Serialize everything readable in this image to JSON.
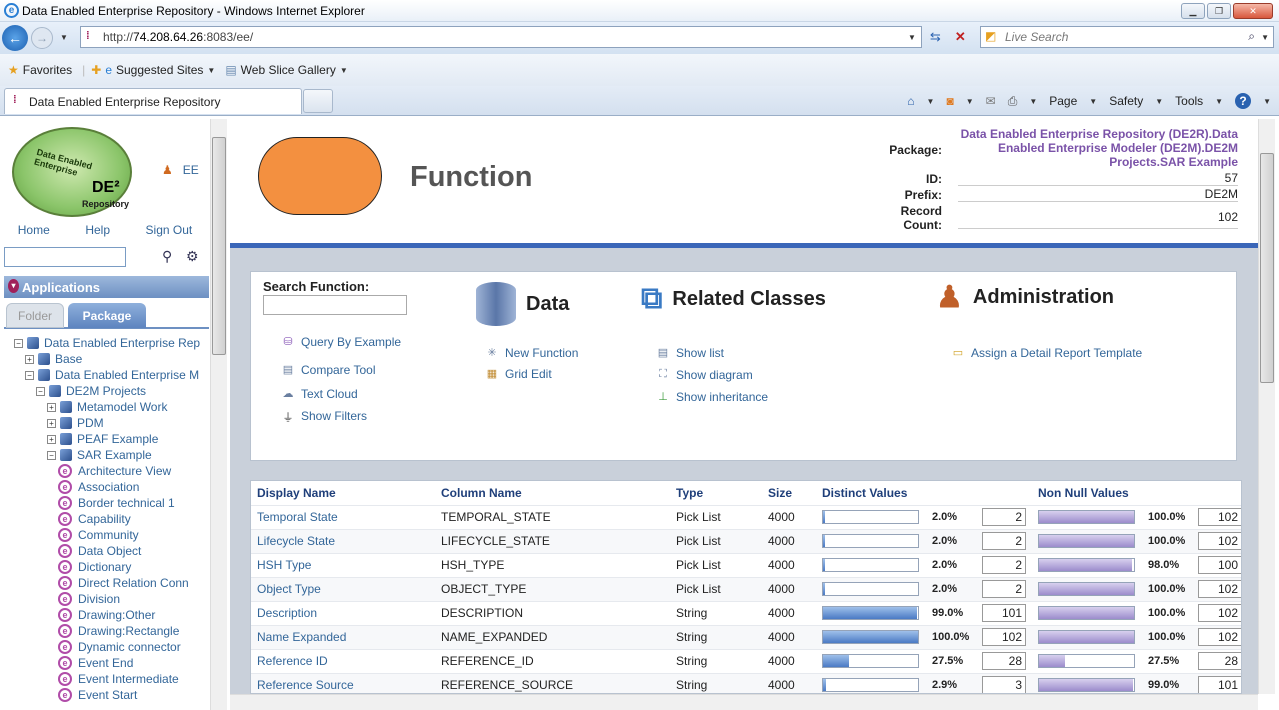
{
  "window": {
    "title": "Data Enabled Enterprise Repository - Windows Internet Explorer"
  },
  "address": {
    "prefix": "http://",
    "host": "74.208.64.26",
    "rest": ":8083/ee/"
  },
  "search": {
    "placeholder": "Live Search"
  },
  "favorites": {
    "label": "Favorites",
    "suggested": "Suggested Sites",
    "webslice": "Web Slice Gallery"
  },
  "tab": {
    "label": "Data Enabled Enterprise Repository"
  },
  "commandbar": {
    "page": "Page",
    "safety": "Safety",
    "tools": "Tools"
  },
  "sidebar": {
    "user": "EE",
    "logo": {
      "line1": "Data Enabled Enterprise",
      "line2": "DE²",
      "line3": "Repository"
    },
    "links": [
      "Home",
      "Help",
      "Sign Out"
    ],
    "applications": "Applications",
    "tabs": {
      "folder": "Folder",
      "package": "Package"
    },
    "tree": [
      {
        "label": "Data Enabled Enterprise Rep",
        "indent": 0,
        "toggle": "−",
        "icon": "package"
      },
      {
        "label": "Base",
        "indent": 1,
        "toggle": "+",
        "icon": "package"
      },
      {
        "label": "Data Enabled Enterprise M",
        "indent": 1,
        "toggle": "−",
        "icon": "package"
      },
      {
        "label": "DE2M Projects",
        "indent": 2,
        "toggle": "−",
        "icon": "package"
      },
      {
        "label": "Metamodel Work",
        "indent": 3,
        "toggle": "+",
        "icon": "package"
      },
      {
        "label": "PDM",
        "indent": 3,
        "toggle": "+",
        "icon": "package"
      },
      {
        "label": "PEAF Example",
        "indent": 3,
        "toggle": "+",
        "icon": "package"
      },
      {
        "label": "SAR Example",
        "indent": 3,
        "toggle": "−",
        "icon": "package"
      },
      {
        "label": "Architecture View",
        "indent": 4,
        "icon": "class"
      },
      {
        "label": "Association",
        "indent": 4,
        "icon": "class"
      },
      {
        "label": "Border technical 1",
        "indent": 4,
        "icon": "class"
      },
      {
        "label": "Capability",
        "indent": 4,
        "icon": "class"
      },
      {
        "label": "Community",
        "indent": 4,
        "icon": "class"
      },
      {
        "label": "Data Object",
        "indent": 4,
        "icon": "class"
      },
      {
        "label": "Dictionary",
        "indent": 4,
        "icon": "class"
      },
      {
        "label": "Direct Relation Conn",
        "indent": 4,
        "icon": "class"
      },
      {
        "label": "Division",
        "indent": 4,
        "icon": "class"
      },
      {
        "label": "Drawing:Other",
        "indent": 4,
        "icon": "class"
      },
      {
        "label": "Drawing:Rectangle",
        "indent": 4,
        "icon": "class"
      },
      {
        "label": "Dynamic connector",
        "indent": 4,
        "icon": "class"
      },
      {
        "label": "Event End",
        "indent": 4,
        "icon": "class"
      },
      {
        "label": "Event Intermediate",
        "indent": 4,
        "icon": "class"
      },
      {
        "label": "Event Start",
        "indent": 4,
        "icon": "class"
      }
    ]
  },
  "header": {
    "title": "Function",
    "shape_color": "#f39040",
    "package_label": "Package:",
    "package_value": "Data Enabled Enterprise Repository (DE2R).Data Enabled Enterprise Modeler (DE2M).DE2M Projects.SAR Example",
    "id_label": "ID:",
    "id_value": "57",
    "prefix_label": "Prefix:",
    "prefix_value": "DE2M",
    "record_label_1": "Record",
    "record_label_2": "Count:",
    "record_value": "102"
  },
  "panel": {
    "search_label": "Search Function:",
    "left_links": [
      "Query By Example",
      "Compare Tool",
      "Text Cloud",
      "Show Filters"
    ],
    "data_title": "Data",
    "data_links": [
      "New Function",
      "Grid Edit"
    ],
    "related_title": "Related Classes",
    "related_links": [
      "Show list",
      "Show diagram",
      "Show inheritance"
    ],
    "admin_title": "Administration",
    "admin_links": [
      "Assign a Detail Report Template"
    ]
  },
  "grid": {
    "headers": [
      "Display Name",
      "Column Name",
      "Type",
      "Size",
      "Distinct Values",
      "Non Null Values"
    ],
    "rows": [
      {
        "display": "Temporal State",
        "column": "TEMPORAL_STATE",
        "type": "Pick List",
        "size": "4000",
        "d_frac": 0.02,
        "d_pct": "2.0%",
        "d_cnt": "2",
        "n_frac": 1.0,
        "n_pct": "100.0%",
        "n_cnt": "102"
      },
      {
        "display": "Lifecycle State",
        "column": "LIFECYCLE_STATE",
        "type": "Pick List",
        "size": "4000",
        "d_frac": 0.02,
        "d_pct": "2.0%",
        "d_cnt": "2",
        "n_frac": 1.0,
        "n_pct": "100.0%",
        "n_cnt": "102"
      },
      {
        "display": "HSH Type",
        "column": "HSH_TYPE",
        "type": "Pick List",
        "size": "4000",
        "d_frac": 0.02,
        "d_pct": "2.0%",
        "d_cnt": "2",
        "n_frac": 0.98,
        "n_pct": "98.0%",
        "n_cnt": "100"
      },
      {
        "display": "Object Type",
        "column": "OBJECT_TYPE",
        "type": "Pick List",
        "size": "4000",
        "d_frac": 0.02,
        "d_pct": "2.0%",
        "d_cnt": "2",
        "n_frac": 1.0,
        "n_pct": "100.0%",
        "n_cnt": "102"
      },
      {
        "display": "Description",
        "column": "DESCRIPTION",
        "type": "String",
        "size": "4000",
        "d_frac": 0.99,
        "d_pct": "99.0%",
        "d_cnt": "101",
        "n_frac": 1.0,
        "n_pct": "100.0%",
        "n_cnt": "102"
      },
      {
        "display": "Name Expanded",
        "column": "NAME_EXPANDED",
        "type": "String",
        "size": "4000",
        "d_frac": 1.0,
        "d_pct": "100.0%",
        "d_cnt": "102",
        "n_frac": 1.0,
        "n_pct": "100.0%",
        "n_cnt": "102"
      },
      {
        "display": "Reference ID",
        "column": "REFERENCE_ID",
        "type": "String",
        "size": "4000",
        "d_frac": 0.275,
        "d_pct": "27.5%",
        "d_cnt": "28",
        "n_frac": 0.275,
        "n_pct": "27.5%",
        "n_cnt": "28"
      },
      {
        "display": "Reference Source",
        "column": "REFERENCE_SOURCE",
        "type": "String",
        "size": "4000",
        "d_frac": 0.029,
        "d_pct": "2.9%",
        "d_cnt": "3",
        "n_frac": 0.99,
        "n_pct": "99.0%",
        "n_cnt": "101"
      }
    ]
  }
}
